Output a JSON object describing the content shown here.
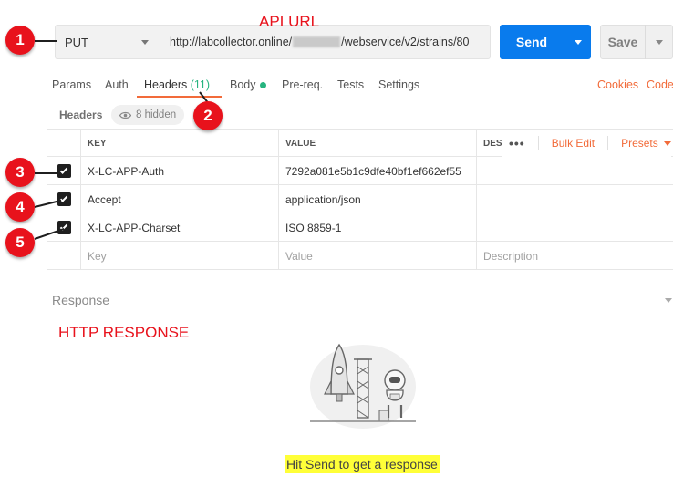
{
  "request": {
    "method": "PUT",
    "url_prefix": "http://labcollector.online/",
    "url_suffix": "/webservice/v2/strains/80",
    "send_label": "Send",
    "save_label": "Save"
  },
  "annotations": {
    "api_url": "API URL",
    "http_response": "HTTP RESPONSE",
    "badges": [
      "1",
      "2",
      "3",
      "4",
      "5"
    ]
  },
  "tabs": {
    "params": "Params",
    "auth": "Auth",
    "headers": "Headers",
    "headers_count": "(11)",
    "body": "Body",
    "prereq": "Pre-req.",
    "tests": "Tests",
    "settings": "Settings",
    "cookies": "Cookies",
    "code": "Code"
  },
  "headers_section": {
    "label": "Headers",
    "hidden": "8 hidden"
  },
  "table": {
    "columns": {
      "key": "KEY",
      "value": "VALUE",
      "description": "DESC"
    },
    "bulk_edit": "Bulk Edit",
    "presets": "Presets",
    "rows": [
      {
        "checked": true,
        "key": "X-LC-APP-Auth",
        "value": "7292a081e5b1c9dfe40bf1ef662ef55",
        "description": ""
      },
      {
        "checked": true,
        "key": "Accept",
        "value": "application/json",
        "description": ""
      },
      {
        "checked": true,
        "key": "X-LC-APP-Charset",
        "value": "ISO 8859-1",
        "description": ""
      }
    ],
    "new_row": {
      "key": "Key",
      "value": "Value",
      "description": "Description"
    }
  },
  "response": {
    "label": "Response",
    "hint": "Hit Send to get a response"
  },
  "colors": {
    "accent_orange": "#f26b3a",
    "send_blue": "#097bed",
    "annotation_red": "#e8121c",
    "count_green": "#26b47f"
  }
}
